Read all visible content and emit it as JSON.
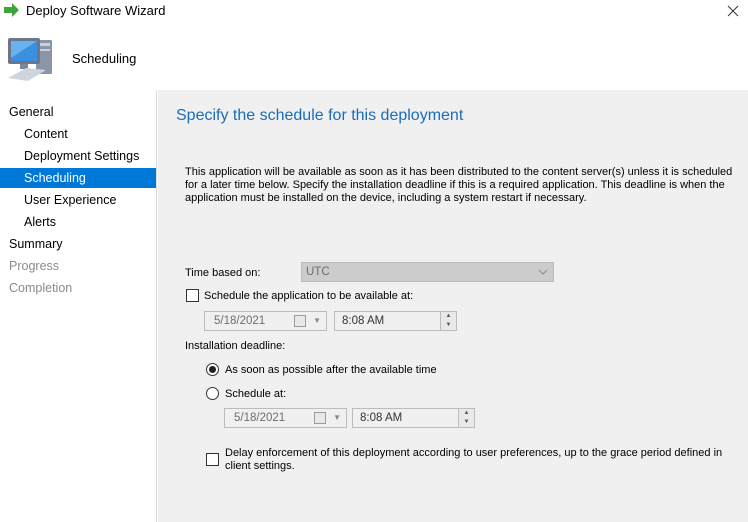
{
  "window": {
    "title": "Deploy Software Wizard"
  },
  "header": {
    "title": "Scheduling"
  },
  "sidebar": {
    "items": [
      {
        "label": "General",
        "state": "normal"
      },
      {
        "label": "Content",
        "state": "normal"
      },
      {
        "label": "Deployment Settings",
        "state": "normal"
      },
      {
        "label": "Scheduling",
        "state": "active"
      },
      {
        "label": "User Experience",
        "state": "normal"
      },
      {
        "label": "Alerts",
        "state": "normal"
      },
      {
        "label": "Summary",
        "state": "normal"
      },
      {
        "label": "Progress",
        "state": "disabled"
      },
      {
        "label": "Completion",
        "state": "disabled"
      }
    ]
  },
  "main": {
    "heading": "Specify the schedule for this deployment",
    "description": "This application will be available as soon as it has been distributed to the content server(s) unless it is scheduled for a later time below. Specify the installation deadline if this is a required application. This deadline is when the application must be installed on the device, including a system restart if necessary.",
    "time_based_on": {
      "label": "Time based on:",
      "value": "UTC"
    },
    "available": {
      "checkbox_label": "Schedule the application to be available at:",
      "checked": false,
      "date": "5/18/2021",
      "time": "8:08 AM"
    },
    "deadline": {
      "label": "Installation deadline:",
      "option_asap": "As soon as possible after the available time",
      "option_schedule": "Schedule at:",
      "selected": "asap",
      "date": "5/18/2021",
      "time": "8:08 AM"
    },
    "delay": {
      "label": "Delay enforcement of this deployment according to user preferences, up to the grace period defined in client settings.",
      "checked": false
    }
  },
  "colors": {
    "accent": "#0078d7",
    "heading": "#1a6db8",
    "panel_bg": "#f0f0f0"
  }
}
